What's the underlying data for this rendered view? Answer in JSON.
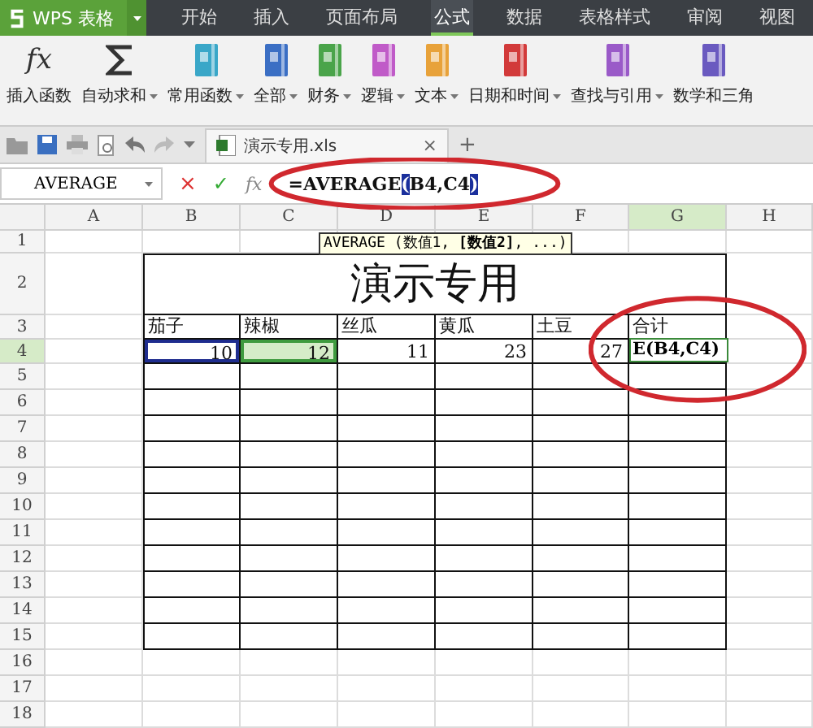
{
  "app_button": {
    "label": "WPS 表格"
  },
  "menu_tabs": [
    {
      "label": "开始",
      "selected": false
    },
    {
      "label": "插入",
      "selected": false
    },
    {
      "label": "页面布局",
      "selected": false
    },
    {
      "label": "公式",
      "selected": true
    },
    {
      "label": "数据",
      "selected": false
    },
    {
      "label": "表格样式",
      "selected": false
    },
    {
      "label": "审阅",
      "selected": false
    },
    {
      "label": "视图",
      "selected": false
    }
  ],
  "ribbon": [
    {
      "label": "插入函数",
      "kind": "fx",
      "dropdown": false
    },
    {
      "label": "自动求和",
      "kind": "sigma",
      "dropdown": true
    },
    {
      "label": "常用函数",
      "kind": "book",
      "color": "#3aa7c8",
      "dropdown": true
    },
    {
      "label": "全部",
      "kind": "book",
      "color": "#3b6fc4",
      "dropdown": true
    },
    {
      "label": "财务",
      "kind": "book",
      "color": "#4aa44a",
      "dropdown": true
    },
    {
      "label": "逻辑",
      "kind": "book",
      "color": "#c05bc8",
      "dropdown": true
    },
    {
      "label": "文本",
      "kind": "book",
      "color": "#e8a23a",
      "dropdown": true
    },
    {
      "label": "日期和时间",
      "kind": "book",
      "color": "#d23a3a",
      "dropdown": true
    },
    {
      "label": "查找与引用",
      "kind": "book",
      "color": "#9a5ac8",
      "dropdown": true
    },
    {
      "label": "数学和三角",
      "kind": "book",
      "color": "#6a5ac0",
      "dropdown": false
    }
  ],
  "document_tab": {
    "title": "演示专用.xls",
    "close": "×",
    "new_tab": "+"
  },
  "formula_bar": {
    "name_box": "AVERAGE",
    "cancel": "×",
    "confirm": "✓",
    "fx": "fx",
    "formula": [
      {
        "text": "=AVERAGE",
        "highlighted": false
      },
      {
        "text": "(",
        "highlighted": true
      },
      {
        "text": "B4,C4",
        "highlighted": false
      },
      {
        "text": ")",
        "highlighted": true
      }
    ]
  },
  "tooltip": "AVERAGE (数值1, **[数值2]**, ...)",
  "sheet": {
    "columns": [
      {
        "label": "A",
        "selected": false
      },
      {
        "label": "B",
        "selected": false
      },
      {
        "label": "C",
        "selected": false
      },
      {
        "label": "D",
        "selected": false
      },
      {
        "label": "E",
        "selected": false
      },
      {
        "label": "F",
        "selected": false
      },
      {
        "label": "G",
        "selected": true
      },
      {
        "label": "H",
        "selected": false
      }
    ],
    "rows": [
      {
        "label": "1",
        "selected": false
      },
      {
        "label": "2",
        "selected": false
      },
      {
        "label": "3",
        "selected": false
      },
      {
        "label": "4",
        "selected": true
      },
      {
        "label": "5",
        "selected": false
      },
      {
        "label": "6",
        "selected": false
      },
      {
        "label": "7",
        "selected": false
      },
      {
        "label": "8",
        "selected": false
      },
      {
        "label": "9",
        "selected": false
      },
      {
        "label": "10",
        "selected": false
      },
      {
        "label": "11",
        "selected": false
      },
      {
        "label": "12",
        "selected": false
      },
      {
        "label": "13",
        "selected": false
      },
      {
        "label": "14",
        "selected": false
      },
      {
        "label": "15",
        "selected": false
      },
      {
        "label": "16",
        "selected": false
      },
      {
        "label": "17",
        "selected": false
      },
      {
        "label": "18",
        "selected": false
      }
    ],
    "title": "演示专用",
    "headers": [
      "茄子",
      "辣椒",
      "丝瓜",
      "黄瓜",
      "土豆",
      "合计"
    ],
    "values": [
      {
        "text": "10",
        "color": "#1f2d8f",
        "selected": false
      },
      {
        "text": "12",
        "color": "#3f9b3f",
        "selected": true
      },
      {
        "text": "11",
        "selected": false
      },
      {
        "text": "23",
        "selected": false
      },
      {
        "text": "27",
        "selected": false
      }
    ],
    "editing": "E(B4,C4)"
  },
  "annotations": [
    {
      "kind": "ellipse"
    },
    {
      "kind": "ellipse"
    }
  ]
}
